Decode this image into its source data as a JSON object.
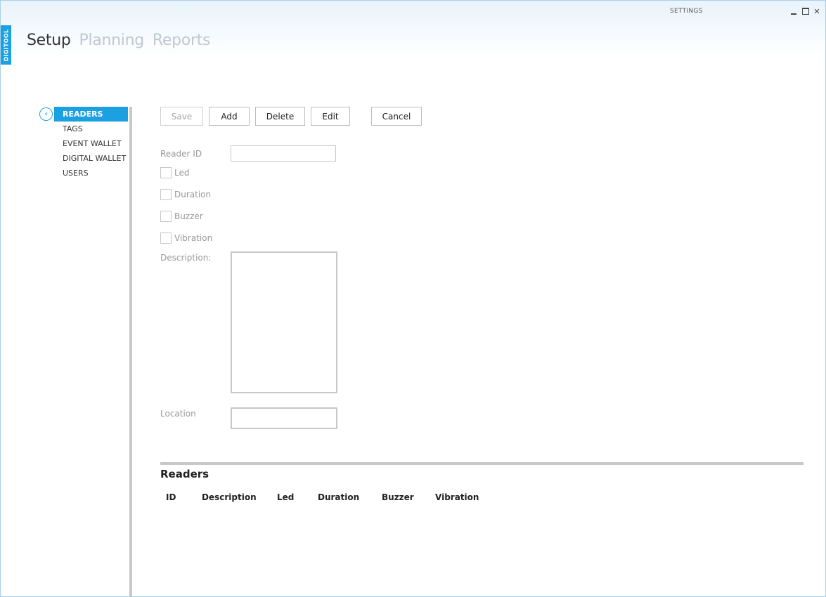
{
  "window": {
    "title": "SETTINGS",
    "brand": "DIGITOOL"
  },
  "main_nav": {
    "items": [
      "Setup",
      "Planning",
      "Reports"
    ],
    "active": "Setup"
  },
  "sidebar": {
    "items": [
      {
        "label": "READERS",
        "active": true
      },
      {
        "label": "TAGS",
        "active": false
      },
      {
        "label": "EVENT WALLET",
        "active": false
      },
      {
        "label": "DIGITAL WALLET",
        "active": false
      },
      {
        "label": "USERS",
        "active": false
      }
    ]
  },
  "toolbar": {
    "save": "Save",
    "add": "Add",
    "delete": "Delete",
    "edit": "Edit",
    "cancel": "Cancel"
  },
  "form": {
    "reader_id_label": "Reader ID",
    "reader_id_value": "",
    "led_label": "Led",
    "duration_label": "Duration",
    "buzzer_label": "Buzzer",
    "vibration_label": "Vibration",
    "description_label": "Description:",
    "description_value": "",
    "location_label": "Location",
    "location_value": ""
  },
  "grid": {
    "title": "Readers",
    "columns": [
      "ID",
      "Description",
      "Led",
      "Duration",
      "Buzzer",
      "Vibration"
    ]
  },
  "colors": {
    "accent": "#1ba1e2",
    "inactive_nav": "#c0c8d0"
  }
}
